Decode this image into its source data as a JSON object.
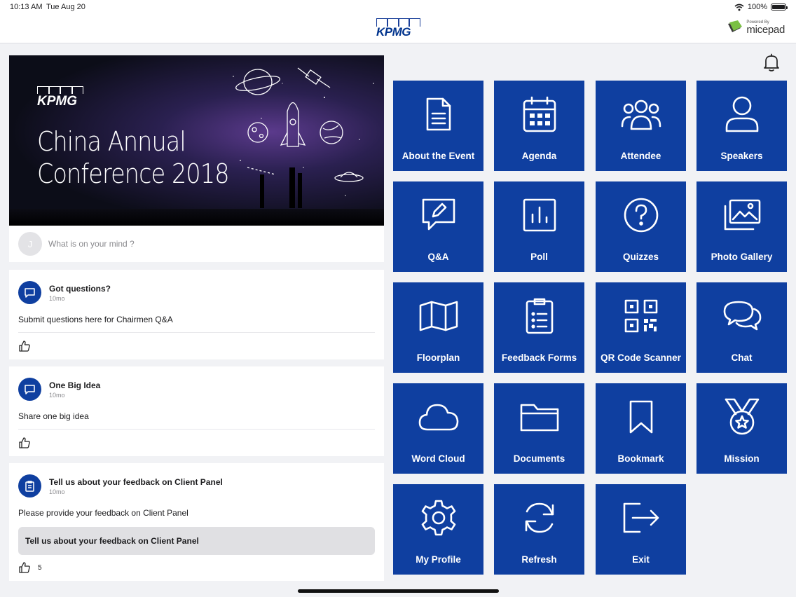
{
  "status_bar": {
    "time": "10:13 AM",
    "date": "Tue Aug 20",
    "battery": "100%"
  },
  "header": {
    "logo": "KPMG",
    "powered_by": "Powered By",
    "brand": "micepad"
  },
  "banner": {
    "logo": "KPMG",
    "title_line1": "China Annual",
    "title_line2": "Conference 2018"
  },
  "composer": {
    "avatar_initial": "J",
    "placeholder": "What is on your mind ?"
  },
  "posts": [
    {
      "title": "Got questions?",
      "time": "10mo",
      "text": "Submit questions here for Chairmen Q&A",
      "icon": "chat-bubble-icon"
    },
    {
      "title": "One Big Idea",
      "time": "10mo",
      "text": "Share one big idea",
      "icon": "chat-bubble-icon"
    },
    {
      "title": "Tell us about your feedback on Client Panel",
      "time": "10mo",
      "text": "Please provide your feedback on Client Panel",
      "cta": "Tell us about your feedback on Client Panel",
      "likes": "5",
      "icon": "clipboard-icon"
    }
  ],
  "tiles": [
    {
      "label": "About the Event",
      "icon": "document-icon"
    },
    {
      "label": "Agenda",
      "icon": "calendar-icon"
    },
    {
      "label": "Attendee",
      "icon": "group-icon"
    },
    {
      "label": "Speakers",
      "icon": "person-icon"
    },
    {
      "label": "Q&A",
      "icon": "chat-edit-icon"
    },
    {
      "label": "Poll",
      "icon": "bar-chart-icon"
    },
    {
      "label": "Quizzes",
      "icon": "question-icon"
    },
    {
      "label": "Photo Gallery",
      "icon": "photos-icon"
    },
    {
      "label": "Floorplan",
      "icon": "map-icon"
    },
    {
      "label": "Feedback Forms",
      "icon": "clipboard-icon"
    },
    {
      "label": "QR Code Scanner",
      "icon": "qr-code-icon"
    },
    {
      "label": "Chat",
      "icon": "chat-bubbles-icon"
    },
    {
      "label": "Word Cloud",
      "icon": "cloud-icon"
    },
    {
      "label": "Documents",
      "icon": "folder-icon"
    },
    {
      "label": "Bookmark",
      "icon": "bookmark-icon"
    },
    {
      "label": "Mission",
      "icon": "medal-icon"
    },
    {
      "label": "My Profile",
      "icon": "gear-icon"
    },
    {
      "label": "Refresh",
      "icon": "refresh-icon"
    },
    {
      "label": "Exit",
      "icon": "exit-icon"
    }
  ],
  "colors": {
    "tile": "#0f3fa0",
    "brand": "#00338d",
    "background": "#f1f2f5"
  }
}
